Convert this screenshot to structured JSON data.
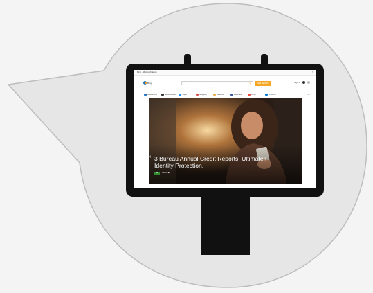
{
  "colors": {
    "bubble_fill": "#e6e6e6",
    "bubble_stroke": "#bdbdbd",
    "monitor": "#111111",
    "search_button": "#f5a623",
    "badge": "#2e8b2e"
  },
  "browser": {
    "window_title": "Bing - Microsoft Edge",
    "close_glyph": "×",
    "logo_text": "Bing",
    "search": {
      "value": "",
      "button_label": "WEB SEARCH"
    },
    "search_links": "Search options   Web   Images   Videos   News   Maps   Shopping",
    "settings_link": "Settings",
    "header_right": {
      "text": "Sign in"
    },
    "favorites": [
      {
        "label": "Outlook.com",
        "icon": "outlook-icon",
        "color": "#1e73be"
      },
      {
        "label": "Microsoft Store",
        "icon": "store-icon",
        "color": "#333333"
      },
      {
        "label": "Skype",
        "icon": "skype-icon",
        "color": "#1e90ff"
      },
      {
        "label": "Shopping",
        "icon": "shopping-icon",
        "color": "#d9534f"
      },
      {
        "label": "Rewards",
        "icon": "rewards-icon",
        "color": "#f0ad4e"
      },
      {
        "label": "Facebook",
        "icon": "facebook-icon",
        "color": "#3b5998"
      },
      {
        "label": "Office",
        "icon": "office-icon",
        "color": "#e74c3c"
      },
      {
        "label": "OneDrive",
        "icon": "onedrive-icon",
        "color": "#0078d7"
      }
    ],
    "favorites_more": "≡ ⋯"
  },
  "hero": {
    "headline": "3 Bureau Annual Credit Reports. Ultimate+ Identity Protection.",
    "badge": "AD",
    "source": "Lifelock ▶",
    "arrow_left": "‹"
  }
}
